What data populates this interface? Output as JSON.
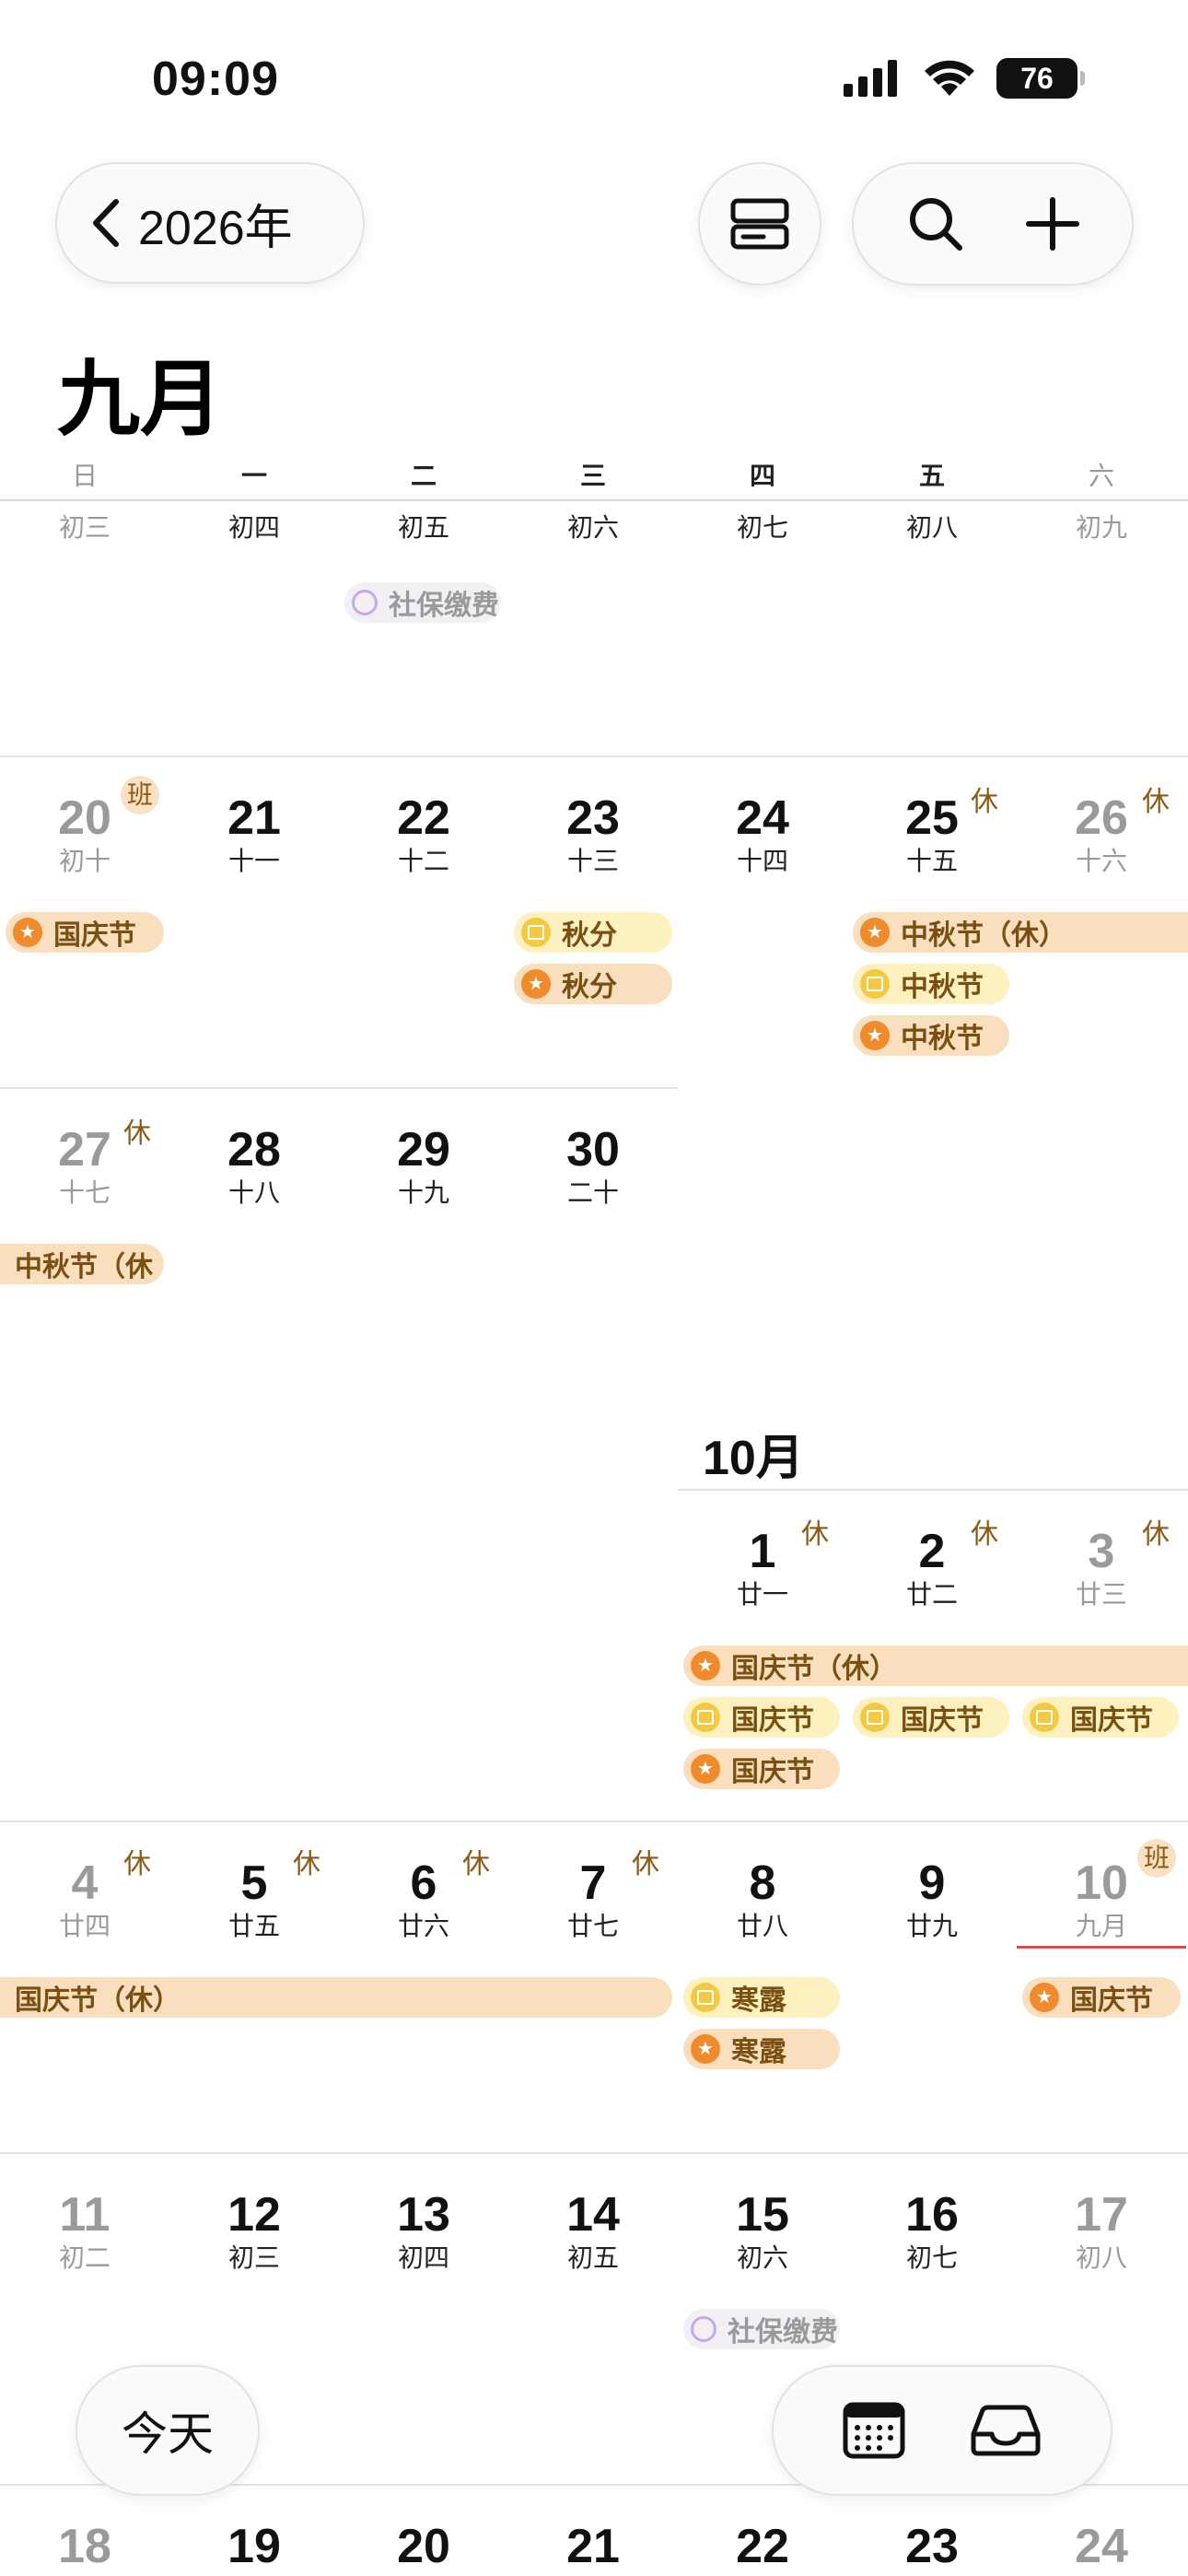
{
  "status": {
    "time": "09:09",
    "battery": "76"
  },
  "nav": {
    "back_label": "2026年",
    "month_title": "九月",
    "month_sub": "10月"
  },
  "weekdays": [
    "日",
    "一",
    "二",
    "三",
    "四",
    "五",
    "六"
  ],
  "row0": {
    "lunar": [
      "初三",
      "初四",
      "初五",
      "初六",
      "初七",
      "初八",
      "初九"
    ]
  },
  "row1": {
    "days": [
      "20",
      "21",
      "22",
      "23",
      "24",
      "25",
      "26"
    ],
    "lunar": [
      "初十",
      "十一",
      "十二",
      "十三",
      "十四",
      "十五",
      "十六"
    ]
  },
  "row2": {
    "days": [
      "27",
      "28",
      "29",
      "30"
    ],
    "lunar": [
      "十七",
      "十八",
      "十九",
      "二十"
    ]
  },
  "row_oct": {
    "days": [
      "1",
      "2",
      "3"
    ],
    "lunar": [
      "廿一",
      "廿二",
      "廿三"
    ]
  },
  "row3": {
    "days": [
      "4",
      "5",
      "6",
      "7",
      "8",
      "9",
      "10"
    ],
    "lunar": [
      "廿四",
      "廿五",
      "廿六",
      "廿七",
      "廿八",
      "廿九",
      "九月"
    ]
  },
  "row4": {
    "days": [
      "11",
      "12",
      "13",
      "14",
      "15",
      "16",
      "17"
    ],
    "lunar": [
      "初二",
      "初三",
      "初四",
      "初五",
      "初六",
      "初七",
      "初八"
    ]
  },
  "row5": {
    "days": [
      "18",
      "19",
      "20",
      "21",
      "22",
      "23",
      "24"
    ]
  },
  "tags": {
    "xiu": "休",
    "ban": "班"
  },
  "events": {
    "shebao": "社保缴费",
    "guoqing": "国庆节",
    "qiufen": "秋分",
    "zhongqiu_xiu": "中秋节（休）",
    "zhongqiu": "中秋节",
    "zhongqiu_xiu_trunc": "中秋节（休",
    "guoqing_xiu": "国庆节（休）",
    "guoqing_short": "国庆节",
    "hanlu": "寒露"
  },
  "bottom": {
    "today_label": "今天"
  }
}
